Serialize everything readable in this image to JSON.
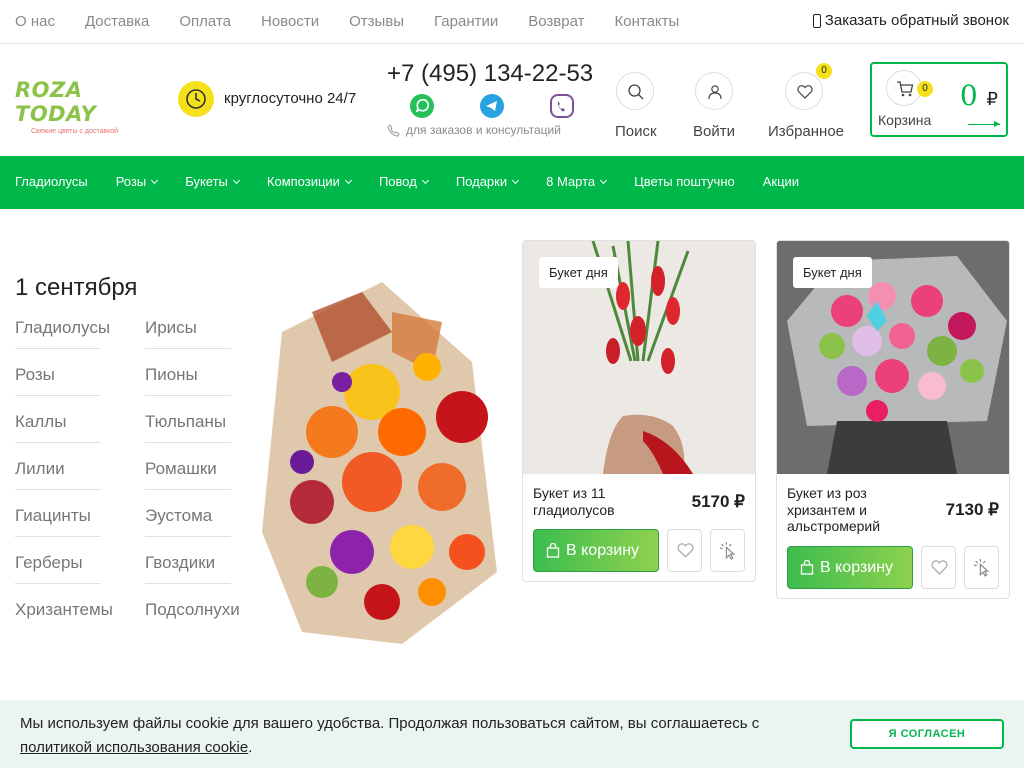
{
  "topnav": {
    "items": [
      "О нас",
      "Доставка",
      "Оплата",
      "Новости",
      "Отзывы",
      "Гарантии",
      "Возврат",
      "Контакты"
    ],
    "callback": "Заказать обратный звонок"
  },
  "header": {
    "logo_text": "ROZA TODAY",
    "logo_sub": "Свежие цветы с доставкой",
    "hours": "круглосуточно 24/7",
    "phone": "+7 (495) 134-22-53",
    "consult": "для заказов и консультаций",
    "search_label": "Поиск",
    "login_label": "Войти",
    "favorites_label": "Избранное",
    "favorites_count": "0",
    "cart_label": "Корзина",
    "cart_count": "0",
    "cart_amount": "0",
    "currency": "₽"
  },
  "mainnav": {
    "items": [
      {
        "label": "Гладиолусы",
        "dropdown": false
      },
      {
        "label": "Розы",
        "dropdown": true
      },
      {
        "label": "Букеты",
        "dropdown": true
      },
      {
        "label": "Композиции",
        "dropdown": true
      },
      {
        "label": "Повод",
        "dropdown": true
      },
      {
        "label": "Подарки",
        "dropdown": true
      },
      {
        "label": "8 Марта",
        "dropdown": true
      },
      {
        "label": "Цветы поштучно",
        "dropdown": false
      },
      {
        "label": "Акции",
        "dropdown": false
      }
    ]
  },
  "content": {
    "date_title": "1 сентября",
    "flowers_left": [
      "Гладиолусы",
      "Розы",
      "Каллы",
      "Лилии",
      "Гиацинты",
      "Герберы",
      "Хризантемы"
    ],
    "flowers_right": [
      "Ирисы",
      "Пионы",
      "Тюльпаны",
      "Ромашки",
      "Эустома",
      "Гвоздики",
      "Подсолнухи"
    ]
  },
  "cards": [
    {
      "tag": "Букет дня",
      "title": "Букет из 11 гладиолусов",
      "price": "5170 ₽",
      "cart_button": "В корзину"
    },
    {
      "tag": "Букет дня",
      "title": "Букет из роз хризантем и альстромерий",
      "price": "7130 ₽",
      "cart_button": "В корзину"
    }
  ],
  "cookie": {
    "text": "Мы используем файлы cookie для вашего удобства. Продолжая пользоваться сайтом, вы соглашаетесь с",
    "link": "политикой использования cookie",
    "end": ".",
    "button": "Я СОГЛАСЕН"
  },
  "colors": {
    "brand_green": "#00b74a",
    "accent_yellow": "#f5e11b",
    "cookie_bg": "#eaf5f1"
  }
}
